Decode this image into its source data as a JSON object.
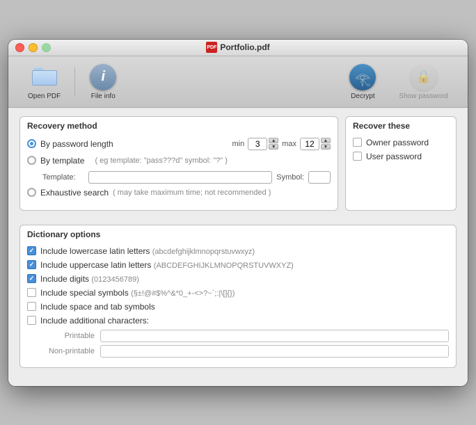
{
  "window": {
    "title": "Portfolio.pdf"
  },
  "toolbar": {
    "open_pdf_label": "Open PDF",
    "file_info_label": "File info",
    "decrypt_label": "Decrypt",
    "show_password_label": "Show password"
  },
  "recovery_method": {
    "title": "Recovery method",
    "option_length_label": "By password length",
    "min_label": "min",
    "min_value": "3",
    "max_label": "max",
    "max_value": "12",
    "option_template_label": "By template",
    "template_hint": "( eg template: \"pass???d\" symbol: \"?\" )",
    "template_field_label": "Template:",
    "symbol_label": "Symbol:",
    "option_exhaustive_label": "Exhaustive search",
    "exhaustive_hint": "( may take maximum time; not recommended )"
  },
  "recover_these": {
    "title": "Recover these",
    "owner_label": "Owner password",
    "user_label": "User password"
  },
  "dictionary_options": {
    "title": "Dictionary options",
    "lowercase_label": "Include lowercase latin letters",
    "lowercase_hint": "(abcdefghijklmnopqrstuvwxyz)",
    "uppercase_label": "Include uppercase latin letters",
    "uppercase_hint": "(ABCDEFGHIJKLMNOPQRSTUVWXYZ)",
    "digits_label": "Include digits",
    "digits_hint": "(0123456789)",
    "special_label": "Include special symbols",
    "special_hint": "(§±!@#$%^&*0_+-<>?~`;:|\\[]{})",
    "space_label": "Include space and tab symbols",
    "additional_label": "Include additional characters:",
    "printable_label": "Printable",
    "nonprintable_label": "Non-printable"
  }
}
